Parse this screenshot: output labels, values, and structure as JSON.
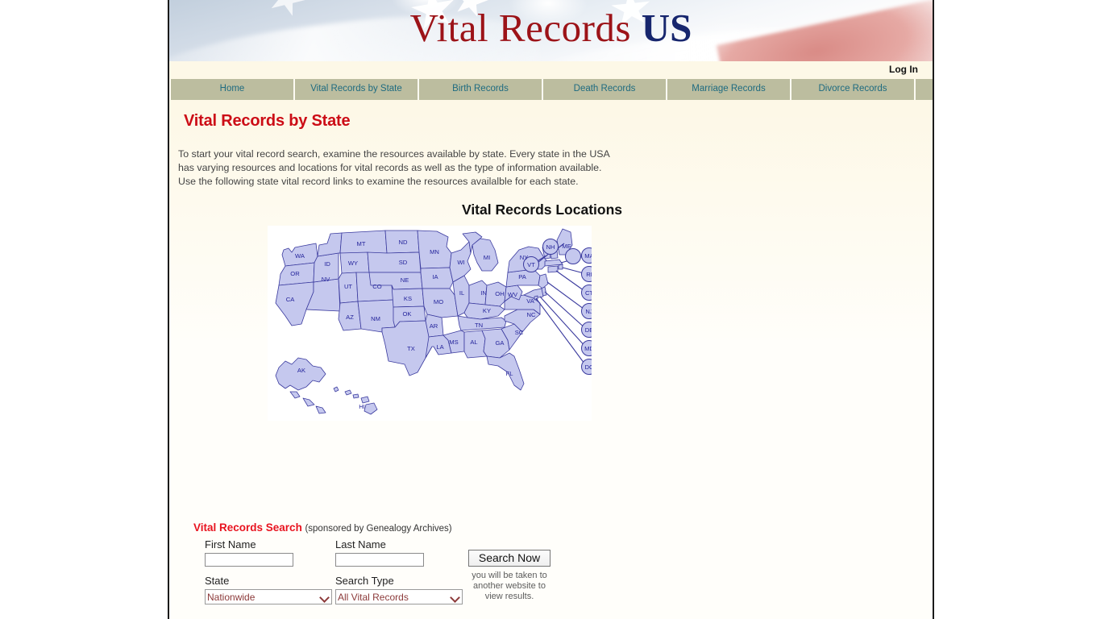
{
  "site": {
    "logo_primary": "Vital Records",
    "logo_suffix": "US",
    "login_label": "Log In"
  },
  "nav": {
    "items": [
      {
        "label": "Home"
      },
      {
        "label": "Vital Records by State"
      },
      {
        "label": "Birth Records"
      },
      {
        "label": "Death Records"
      },
      {
        "label": "Marriage Records"
      },
      {
        "label": "Divorce Records"
      }
    ]
  },
  "page": {
    "title": "Vital Records by State",
    "intro_line1": "To start your vital record search, examine the resources available by state. Every state in the USA",
    "intro_line2": "has varying resources and locations for vital records as well as the type of information available.",
    "intro_line3": "Use the following state vital record links to examine the resources availalble for each state."
  },
  "map": {
    "title": "Vital Records Locations",
    "fill_color": "#c5c8ee",
    "stroke_color": "#3a3a9e",
    "label_color": "#23239b",
    "background": "#ffffff",
    "states": [
      "WA",
      "OR",
      "ID",
      "MT",
      "ND",
      "MN",
      "WI",
      "MI",
      "NY",
      "ME",
      "VT",
      "NH",
      "MA",
      "RI",
      "CT",
      "NJ",
      "DE",
      "MD",
      "DC",
      "SD",
      "WY",
      "NE",
      "IA",
      "IL",
      "IN",
      "OH",
      "PA",
      "WV",
      "VA",
      "NC",
      "SC",
      "GA",
      "FL",
      "AL",
      "MS",
      "TN",
      "KY",
      "AR",
      "LA",
      "MO",
      "KS",
      "OK",
      "TX",
      "NM",
      "AZ",
      "UT",
      "CO",
      "NV",
      "CA",
      "AK",
      "HI"
    ],
    "callout_states": [
      "VT",
      "NH",
      "MA",
      "RI",
      "CT",
      "NJ",
      "DE",
      "MD",
      "DC",
      "ME"
    ]
  },
  "search": {
    "title": "Vital Records Search",
    "sponsor": "(sponsored by Genealogy Archives)",
    "first_name_label": "First Name",
    "first_name_value": "",
    "last_name_label": "Last Name",
    "last_name_value": "",
    "state_label": "State",
    "state_value": "Nationwide",
    "state_options": [
      "Nationwide"
    ],
    "type_label": "Search Type",
    "type_value": "All Vital Records",
    "type_options": [
      "All Vital Records"
    ],
    "button_label": "Search Now",
    "note_line1": "you will be taken to",
    "note_line2": "another website to",
    "note_line3": "view results."
  },
  "colors": {
    "title_red": "#cc0c16",
    "logo_red": "#9c1318",
    "logo_navy": "#17266e",
    "nav_bg": "#bcbd9f",
    "nav_link": "#1e6b80",
    "search_red": "#e8131f",
    "select_text": "#8c3a3a"
  }
}
